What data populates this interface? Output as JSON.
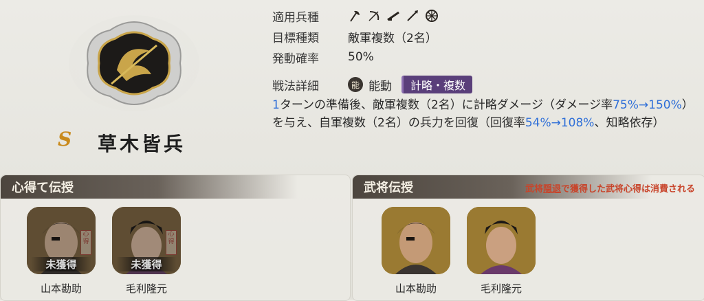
{
  "skill": {
    "rarity": "S",
    "name": "草木皆兵",
    "emblem_icon": "spiral-sword-emblem-icon"
  },
  "info": {
    "unit_types_label": "適用兵種",
    "unit_type_icons": [
      "axe-icon",
      "bow-icon",
      "gun-icon",
      "spear-icon",
      "wheel-icon"
    ],
    "target_label": "目標種類",
    "target_value": "敵軍複数（2名）",
    "rate_label": "発動確率",
    "rate_value": "50%",
    "detail_label": "戦法詳細",
    "ability_badge": "能",
    "ability_type": "能動",
    "category_tag": "計略・複数"
  },
  "description": {
    "p1": "1",
    "p2": "ターンの準備後、敵軍複数（2名）に計略ダメージ（ダメージ率",
    "p3": "75%→150%",
    "p4": "）を与え、自軍複数（2名）の兵力を回復（回復率",
    "p5": "54%→108%",
    "p6": "、知略依存）"
  },
  "left_panel": {
    "title": "心得て伝授",
    "cards": [
      {
        "name": "山本勘助",
        "status": "未獲得",
        "seal": "心得"
      },
      {
        "name": "毛利隆元",
        "status": "未獲得",
        "seal": "心得"
      }
    ]
  },
  "right_panel": {
    "title": "武将伝授",
    "note_a": "武将",
    "note_link": "隠退",
    "note_b": "で獲得した武将心得は消費される",
    "cards": [
      {
        "name": "山本勘助"
      },
      {
        "name": "毛利隆元"
      }
    ]
  },
  "colors": {
    "accent_blue": "#2f6fd8",
    "tag_purple": "#5a3f7a",
    "rarity_gold": "#c98a1c",
    "warning_red": "#c8442a"
  }
}
